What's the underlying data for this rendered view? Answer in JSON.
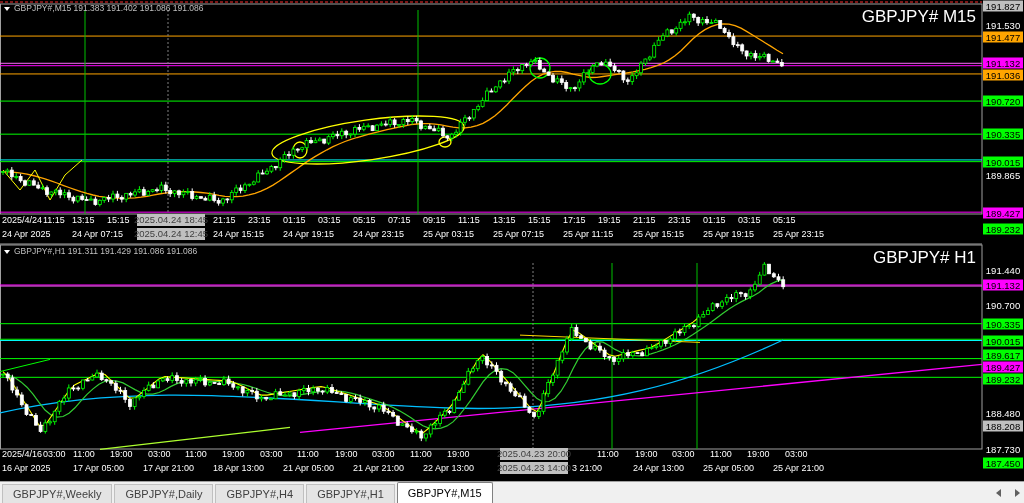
{
  "charts": [
    {
      "header": "GBPJPY#,M15  191.383 191.402 191.086 191.086",
      "title": "GBPJPY# M15",
      "price_labels": [
        {
          "text": "191.827",
          "kind": "tag",
          "color": "#c0c0c0"
        },
        {
          "text": "191.530",
          "kind": "plain"
        },
        {
          "text": "191.477",
          "kind": "tag",
          "color": "#ffa500"
        },
        {
          "text": "191.132",
          "kind": "tag",
          "color": "#ff00ff"
        },
        {
          "text": "191.036",
          "kind": "tag",
          "color": "#ffa500"
        },
        {
          "text": "190.720",
          "kind": "tag",
          "color": "#00ff00"
        },
        {
          "text": "190.335",
          "kind": "tag",
          "color": "#00ff00"
        },
        {
          "text": "190.015",
          "kind": "tag",
          "color": "#00ff00"
        },
        {
          "text": "189.865",
          "kind": "plain"
        },
        {
          "text": "189.427",
          "kind": "tag",
          "color": "#ff00ff"
        },
        {
          "text": "189.232",
          "kind": "tag",
          "color": "#00ff00"
        }
      ],
      "time_labels_upper": [
        {
          "text": "2025/4/24",
          "kind": "plain"
        },
        {
          "text": "11:15",
          "kind": "plain"
        },
        {
          "text": "13:15",
          "kind": "plain"
        },
        {
          "text": "15:15",
          "kind": "plain"
        },
        {
          "text": "2025.04.24 18:45",
          "kind": "crosshair"
        },
        {
          "text": "21:15",
          "kind": "plain"
        },
        {
          "text": "23:15",
          "kind": "plain"
        },
        {
          "text": "01:15",
          "kind": "plain"
        },
        {
          "text": "03:15",
          "kind": "plain"
        },
        {
          "text": "05:15",
          "kind": "plain"
        },
        {
          "text": "07:15",
          "kind": "plain"
        },
        {
          "text": "09:15",
          "kind": "plain"
        },
        {
          "text": "11:15",
          "kind": "plain"
        },
        {
          "text": "13:15",
          "kind": "plain"
        },
        {
          "text": "15:15",
          "kind": "plain"
        },
        {
          "text": "17:15",
          "kind": "plain"
        },
        {
          "text": "19:15",
          "kind": "plain"
        },
        {
          "text": "21:15",
          "kind": "plain"
        },
        {
          "text": "23:15",
          "kind": "plain"
        },
        {
          "text": "01:15",
          "kind": "plain"
        },
        {
          "text": "03:15",
          "kind": "plain"
        },
        {
          "text": "05:15",
          "kind": "plain"
        }
      ],
      "time_labels_lower": [
        {
          "text": "24 Apr 2025",
          "kind": "plain"
        },
        {
          "text": "24 Apr 07:15",
          "kind": "plain"
        },
        {
          "text": "2025.04.24 12:45",
          "kind": "crosshair"
        },
        {
          "text": "24 Apr 15:15",
          "kind": "plain"
        },
        {
          "text": "24 Apr 19:15",
          "kind": "plain"
        },
        {
          "text": "24 Apr 23:15",
          "kind": "plain"
        },
        {
          "text": "25 Apr 03:15",
          "kind": "plain"
        },
        {
          "text": "25 Apr 07:15",
          "kind": "plain"
        },
        {
          "text": "25 Apr 11:15",
          "kind": "plain"
        },
        {
          "text": "25 Apr 15:15",
          "kind": "plain"
        },
        {
          "text": "25 Apr 19:15",
          "kind": "plain"
        },
        {
          "text": "25 Apr 23:15",
          "kind": "plain"
        }
      ]
    },
    {
      "header": "GBPJPY#,H1  191.311 191.429 191.086 191.086",
      "title": "GBPJPY# H1",
      "price_labels": [
        {
          "text": "191.440",
          "kind": "plain"
        },
        {
          "text": "191.132",
          "kind": "tag",
          "color": "#ff00ff"
        },
        {
          "text": "190.700",
          "kind": "plain"
        },
        {
          "text": "190.335",
          "kind": "tag",
          "color": "#00ff00"
        },
        {
          "text": "190.015",
          "kind": "tag",
          "color": "#00ff00"
        },
        {
          "text": "189.617",
          "kind": "tag",
          "color": "#00ff00"
        },
        {
          "text": "189.427",
          "kind": "tag",
          "color": "#ff00ff"
        },
        {
          "text": "189.232",
          "kind": "tag",
          "color": "#00ff00"
        },
        {
          "text": "188.480",
          "kind": "plain"
        },
        {
          "text": "188.208",
          "kind": "tag",
          "color": "#c0c0c0"
        },
        {
          "text": "187.730",
          "kind": "plain"
        },
        {
          "text": "187.450",
          "kind": "tag",
          "color": "#00ff00"
        }
      ],
      "time_labels_upper": [
        {
          "text": "2025/4/16",
          "kind": "plain"
        },
        {
          "text": "03:00",
          "kind": "plain"
        },
        {
          "text": "11:00",
          "kind": "plain"
        },
        {
          "text": "19:00",
          "kind": "plain"
        },
        {
          "text": "03:00",
          "kind": "plain"
        },
        {
          "text": "11:00",
          "kind": "plain"
        },
        {
          "text": "19:00",
          "kind": "plain"
        },
        {
          "text": "03:00",
          "kind": "plain"
        },
        {
          "text": "11:00",
          "kind": "plain"
        },
        {
          "text": "19:00",
          "kind": "plain"
        },
        {
          "text": "03:00",
          "kind": "plain"
        },
        {
          "text": "11:00",
          "kind": "plain"
        },
        {
          "text": "19:00",
          "kind": "plain"
        },
        {
          "text": "2025.04.23 20:00",
          "kind": "crosshair"
        },
        {
          "text": "11:00",
          "kind": "plain"
        },
        {
          "text": "19:00",
          "kind": "plain"
        },
        {
          "text": "03:00",
          "kind": "plain"
        },
        {
          "text": "11:00",
          "kind": "plain"
        },
        {
          "text": "19:00",
          "kind": "plain"
        },
        {
          "text": "03:00",
          "kind": "plain"
        }
      ],
      "time_labels_lower": [
        {
          "text": "16 Apr 2025",
          "kind": "plain"
        },
        {
          "text": "17 Apr 05:00",
          "kind": "plain"
        },
        {
          "text": "17 Apr 21:00",
          "kind": "plain"
        },
        {
          "text": "18 Apr 13:00",
          "kind": "plain"
        },
        {
          "text": "21 Apr 05:00",
          "kind": "plain"
        },
        {
          "text": "21 Apr 21:00",
          "kind": "plain"
        },
        {
          "text": "22 Apr 13:00",
          "kind": "plain"
        },
        {
          "text": "2025.04.23 14:00",
          "kind": "crosshair"
        },
        {
          "text": "3 21:00",
          "kind": "plain"
        },
        {
          "text": "24 Apr 13:00",
          "kind": "plain"
        },
        {
          "text": "25 Apr 05:00",
          "kind": "plain"
        },
        {
          "text": "25 Apr 21:00",
          "kind": "plain"
        }
      ]
    }
  ],
  "tabs": [
    {
      "label": "GBPJPY#,Weekly",
      "selected": false
    },
    {
      "label": "GBPJPY#,Daily",
      "selected": false
    },
    {
      "label": "GBPJPY#,H4",
      "selected": false
    },
    {
      "label": "GBPJPY#,H1",
      "selected": false
    },
    {
      "label": "GBPJPY#,M15",
      "selected": true
    }
  ]
}
